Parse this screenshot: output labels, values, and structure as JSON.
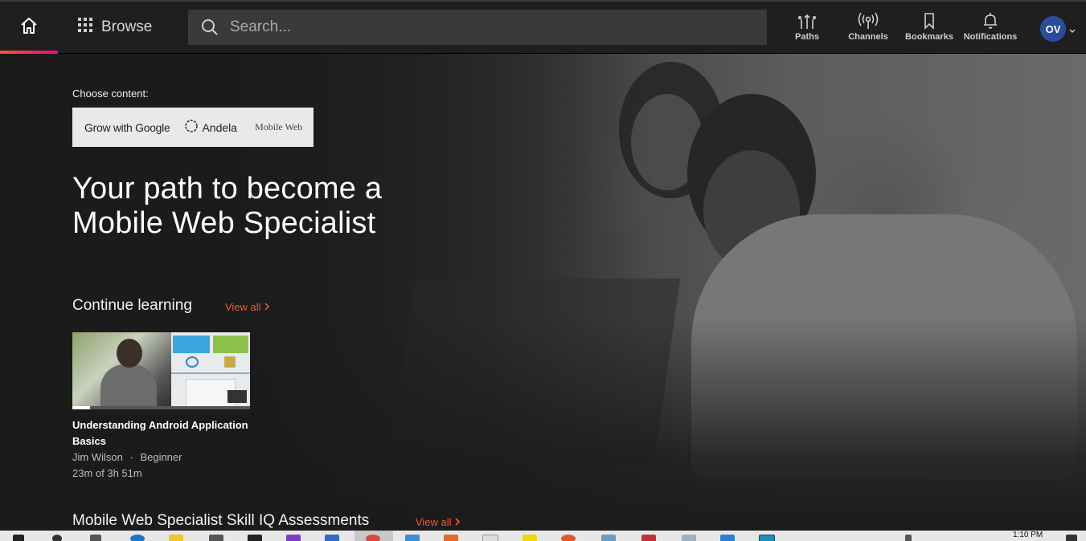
{
  "nav": {
    "browse_label": "Browse",
    "search_placeholder": "Search...",
    "items": [
      {
        "label": "Paths",
        "icon": "paths-icon"
      },
      {
        "label": "Channels",
        "icon": "channels-icon"
      },
      {
        "label": "Bookmarks",
        "icon": "bookmark-icon"
      },
      {
        "label": "Notifications",
        "icon": "bell-icon"
      }
    ],
    "avatar_initials": "OV"
  },
  "hero": {
    "choose_label": "Choose content:",
    "partners": {
      "google": "Grow with Google",
      "andela": "Andela",
      "mobile_web": "Mobile Web"
    },
    "title": "Your path to become a Mobile Web Specialist"
  },
  "continue_learning": {
    "title": "Continue learning",
    "view_all": "View all",
    "course": {
      "title": "Understanding Android Application Basics",
      "author": "Jim Wilson",
      "separator": "·",
      "level": "Beginner",
      "progress_text": "23m of 3h 51m",
      "progress_fraction": 0.1
    }
  },
  "assessments": {
    "title": "Mobile Web Specialist Skill IQ Assessments",
    "view_all": "View all"
  },
  "taskbar": {
    "time": "1:10 PM"
  },
  "colors": {
    "accent": "#f15b2a",
    "accent_pink": "#e80a89",
    "avatar": "#2b4c9b"
  }
}
